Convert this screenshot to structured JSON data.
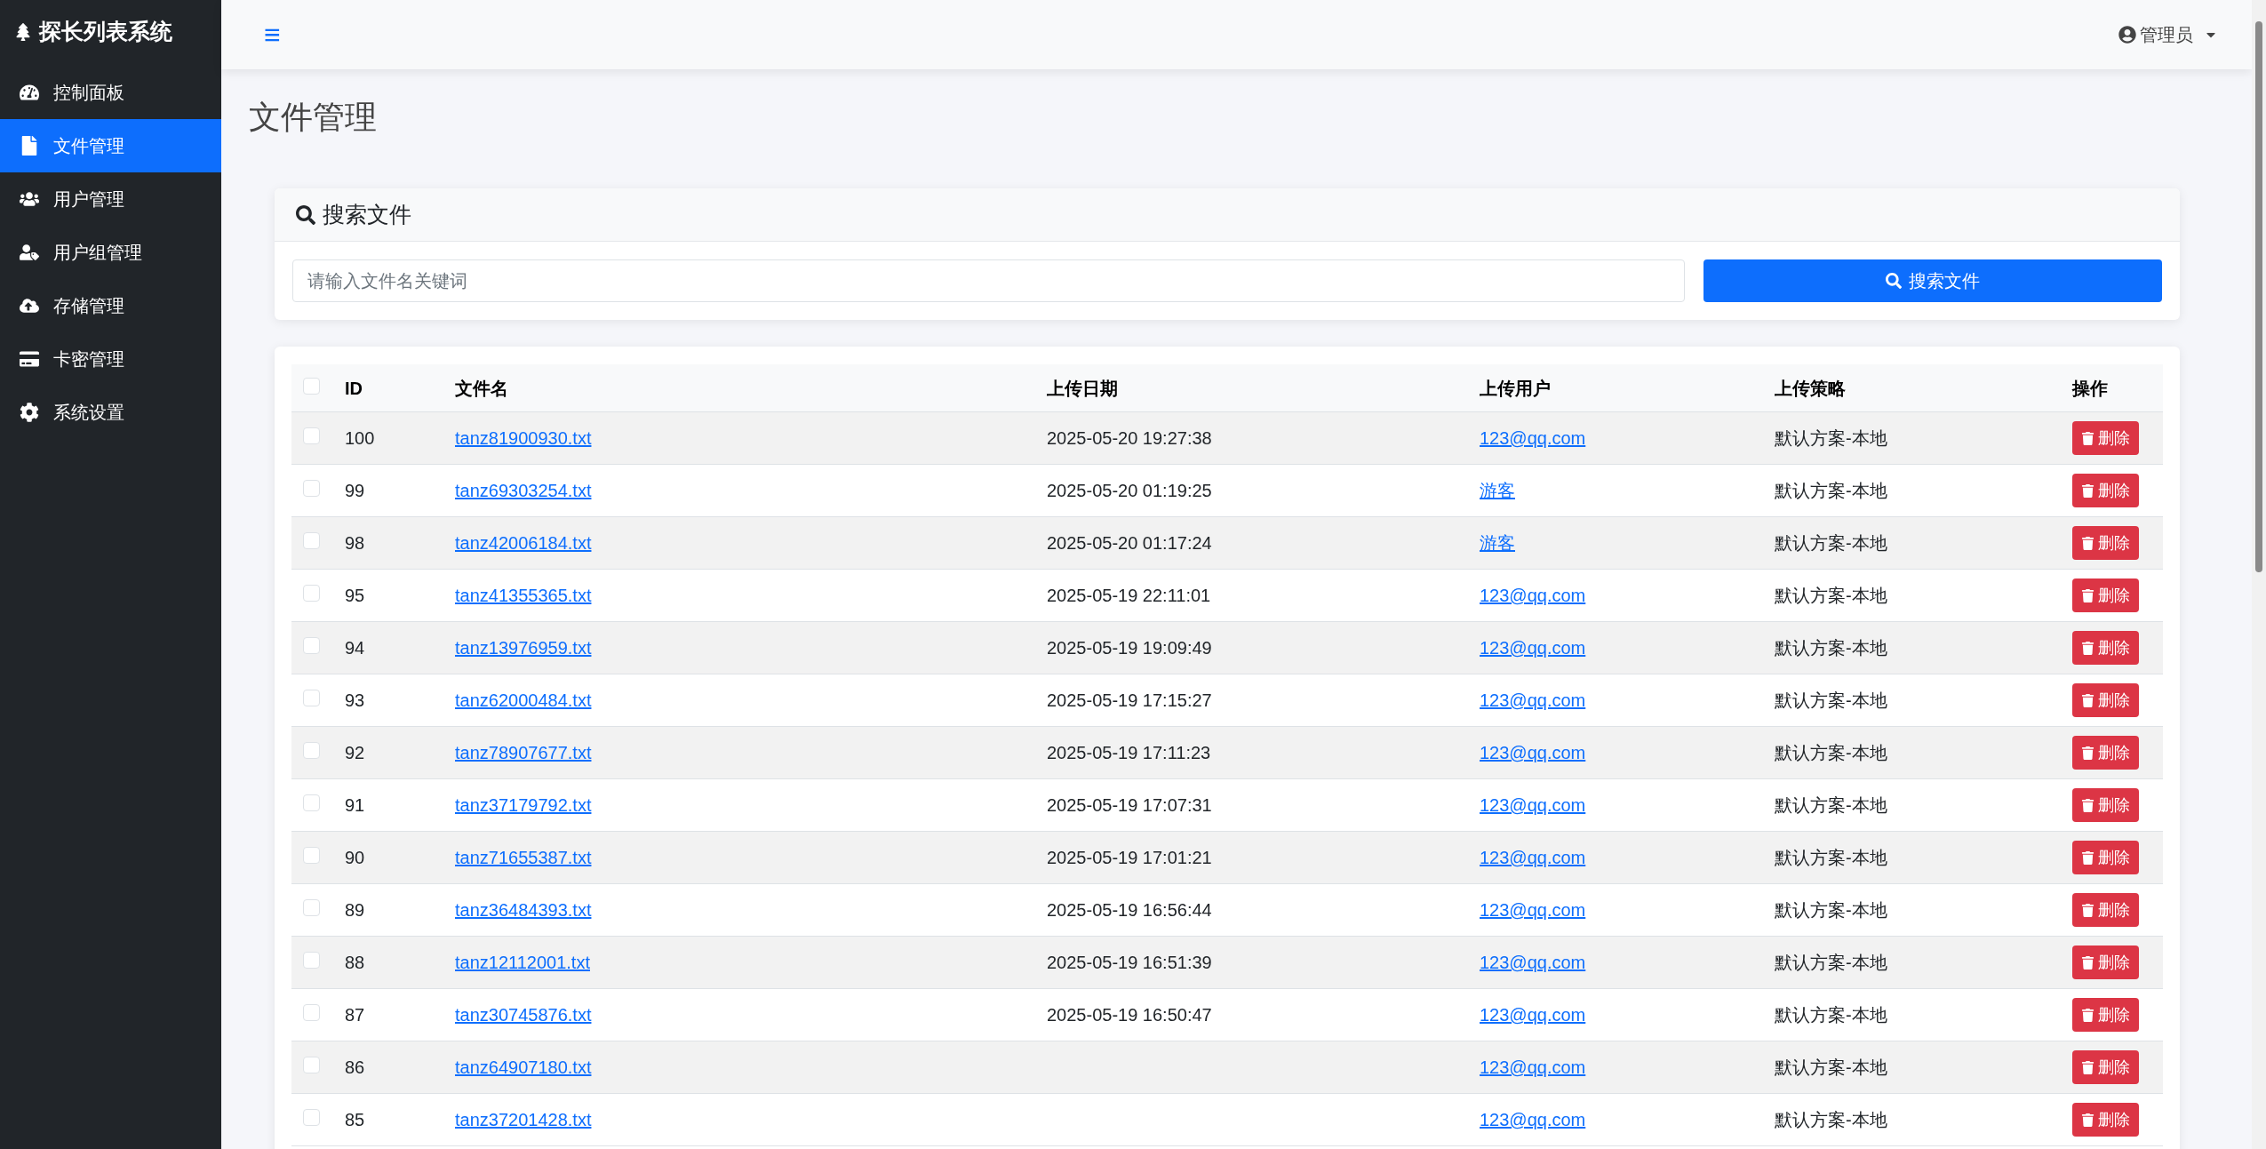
{
  "brand": "探长列表系统",
  "sidebar": {
    "items": [
      {
        "label": "控制面板",
        "selected": false
      },
      {
        "label": "文件管理",
        "selected": true
      },
      {
        "label": "用户管理",
        "selected": false
      },
      {
        "label": "用户组管理",
        "selected": false
      },
      {
        "label": "存储管理",
        "selected": false
      },
      {
        "label": "卡密管理",
        "selected": false
      },
      {
        "label": "系统设置",
        "selected": false
      }
    ]
  },
  "topbar": {
    "menu_icon": "≡",
    "user": "管理员"
  },
  "page_title": "文件管理",
  "search": {
    "title": "搜索文件",
    "placeholder": "请输入文件名关键词",
    "button": "搜索文件"
  },
  "table": {
    "select_all_checked": false,
    "columns": [
      "ID",
      "文件名",
      "上传日期",
      "上传用户",
      "上传策略",
      "操作"
    ],
    "rows": [
      {
        "id": "100",
        "name": "tanz81900930.txt",
        "date": "2025-05-20 19:27:38",
        "user": "123@qq.com",
        "policy": "默认方案-本地",
        "action": "删除",
        "checked": false
      },
      {
        "id": "99",
        "name": "tanz69303254.txt",
        "date": "2025-05-20 01:19:25",
        "user": "游客",
        "policy": "默认方案-本地",
        "action": "删除",
        "checked": false
      },
      {
        "id": "98",
        "name": "tanz42006184.txt",
        "date": "2025-05-20 01:17:24",
        "user": "游客",
        "policy": "默认方案-本地",
        "action": "删除",
        "checked": false
      },
      {
        "id": "95",
        "name": "tanz41355365.txt",
        "date": "2025-05-19 22:11:01",
        "user": "123@qq.com",
        "policy": "默认方案-本地",
        "action": "删除",
        "checked": false
      },
      {
        "id": "94",
        "name": "tanz13976959.txt",
        "date": "2025-05-19 19:09:49",
        "user": "123@qq.com",
        "policy": "默认方案-本地",
        "action": "删除",
        "checked": false
      },
      {
        "id": "93",
        "name": "tanz62000484.txt",
        "date": "2025-05-19 17:15:27",
        "user": "123@qq.com",
        "policy": "默认方案-本地",
        "action": "删除",
        "checked": false
      },
      {
        "id": "92",
        "name": "tanz78907677.txt",
        "date": "2025-05-19 17:11:23",
        "user": "123@qq.com",
        "policy": "默认方案-本地",
        "action": "删除",
        "checked": false
      },
      {
        "id": "91",
        "name": "tanz37179792.txt",
        "date": "2025-05-19 17:07:31",
        "user": "123@qq.com",
        "policy": "默认方案-本地",
        "action": "删除",
        "checked": false
      },
      {
        "id": "90",
        "name": "tanz71655387.txt",
        "date": "2025-05-19 17:01:21",
        "user": "123@qq.com",
        "policy": "默认方案-本地",
        "action": "删除",
        "checked": false
      },
      {
        "id": "89",
        "name": "tanz36484393.txt",
        "date": "2025-05-19 16:56:44",
        "user": "123@qq.com",
        "policy": "默认方案-本地",
        "action": "删除",
        "checked": false
      },
      {
        "id": "88",
        "name": "tanz12112001.txt",
        "date": "2025-05-19 16:51:39",
        "user": "123@qq.com",
        "policy": "默认方案-本地",
        "action": "删除",
        "checked": false
      },
      {
        "id": "87",
        "name": "tanz30745876.txt",
        "date": "2025-05-19 16:50:47",
        "user": "123@qq.com",
        "policy": "默认方案-本地",
        "action": "删除",
        "checked": false
      },
      {
        "id": "86",
        "name": "tanz64907180.txt",
        "user": "123@qq.com",
        "policy": "默认方案-本地",
        "action": "删除",
        "checked": false
      },
      {
        "id": "85",
        "name": "tanz37201428.txt",
        "user": "123@qq.com",
        "policy": "默认方案-本地",
        "action": "删除",
        "checked": false
      }
    ]
  }
}
